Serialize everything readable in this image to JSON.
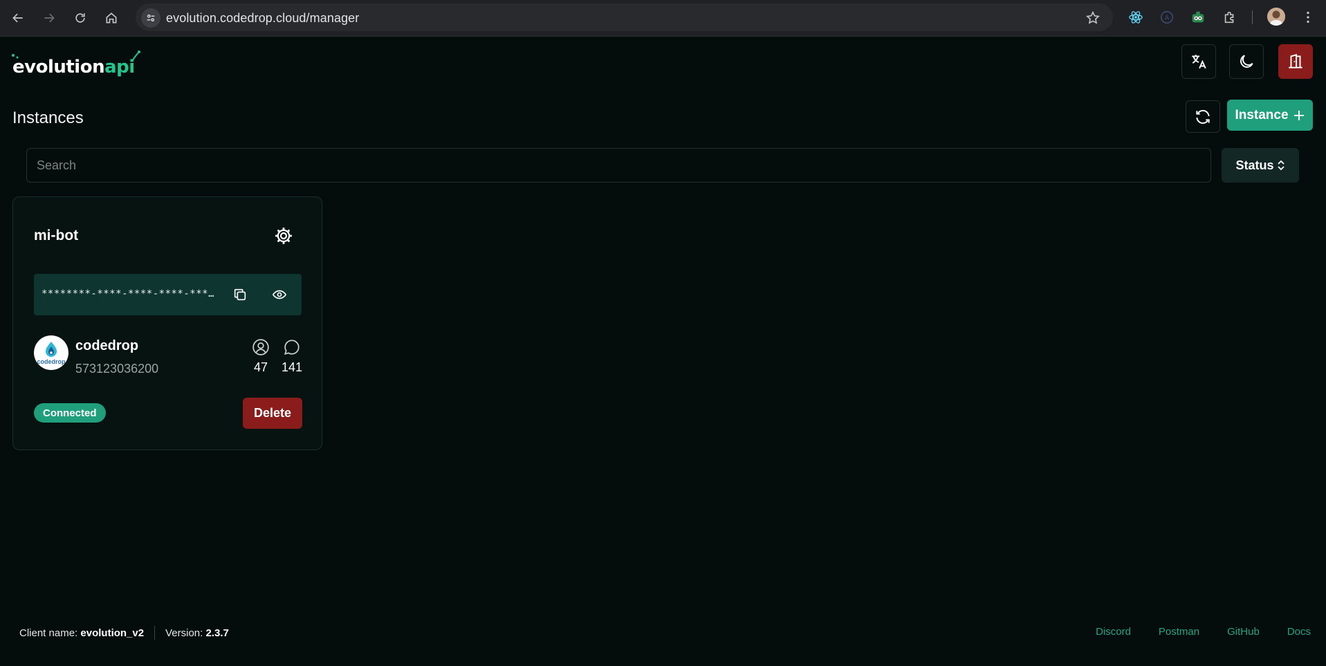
{
  "browser": {
    "url": "evolution.codedrop.cloud/manager"
  },
  "app": {
    "logo_main": "evolution",
    "logo_accent": "api",
    "page_title": "Instances",
    "new_instance_label": "Instance",
    "search_placeholder": "Search",
    "status_filter_label": "Status"
  },
  "instance": {
    "name": "mi-bot",
    "token_masked": "********-****-****-****-************",
    "profile_name": "codedrop",
    "avatar_text": "codedrop",
    "phone": "573123036200",
    "contacts_count": "47",
    "chats_count": "141",
    "status": "Connected",
    "delete_label": "Delete"
  },
  "footer": {
    "client_label": "Client name:",
    "client_value": "evolution_v2",
    "version_label": "Version:",
    "version_value": "2.3.7",
    "links": [
      "Discord",
      "Postman",
      "GitHub",
      "Docs"
    ]
  },
  "colors": {
    "accent": "#1f9f7c",
    "danger": "#8a1c1c",
    "background": "#050d0c"
  },
  "icons": {
    "header": [
      "translate-icon",
      "moon-icon",
      "logout-icon"
    ],
    "card": [
      "gear-icon",
      "copy-icon",
      "eye-icon",
      "user-icon",
      "chat-icon"
    ]
  }
}
